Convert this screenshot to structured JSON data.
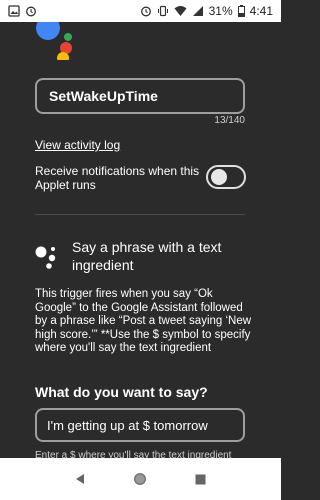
{
  "status": {
    "battery": "31%",
    "time": "4:41"
  },
  "colors": {
    "background": "#2b2b2b",
    "google_blue": "#4285F4",
    "google_red": "#EA4335",
    "google_yellow": "#FBBC05",
    "google_green": "#34A853"
  },
  "applet": {
    "name": "SetWakeUpTime",
    "char_count": "13/140",
    "activity_link": "View activity log",
    "notifications_label": "Receive notifications when this Applet runs",
    "notifications_enabled": false
  },
  "trigger": {
    "icon": "google-assistant-icon",
    "title": "Say a phrase with a text ingredient",
    "description": "This trigger fires when you say “Ok Google” to the Google Assistant followed by a phrase like “Post a tweet saying ‘New high score.’” **Use the $ symbol to specify where you'll say the text ingredient"
  },
  "field": {
    "question": "What do you want to say?",
    "value": "I'm getting up at $ tomorrow",
    "hint": "Enter a $ where you'll say the text ingredient"
  },
  "navbar": {
    "back": "back-icon",
    "home": "home-icon",
    "recents": "recents-icon"
  }
}
